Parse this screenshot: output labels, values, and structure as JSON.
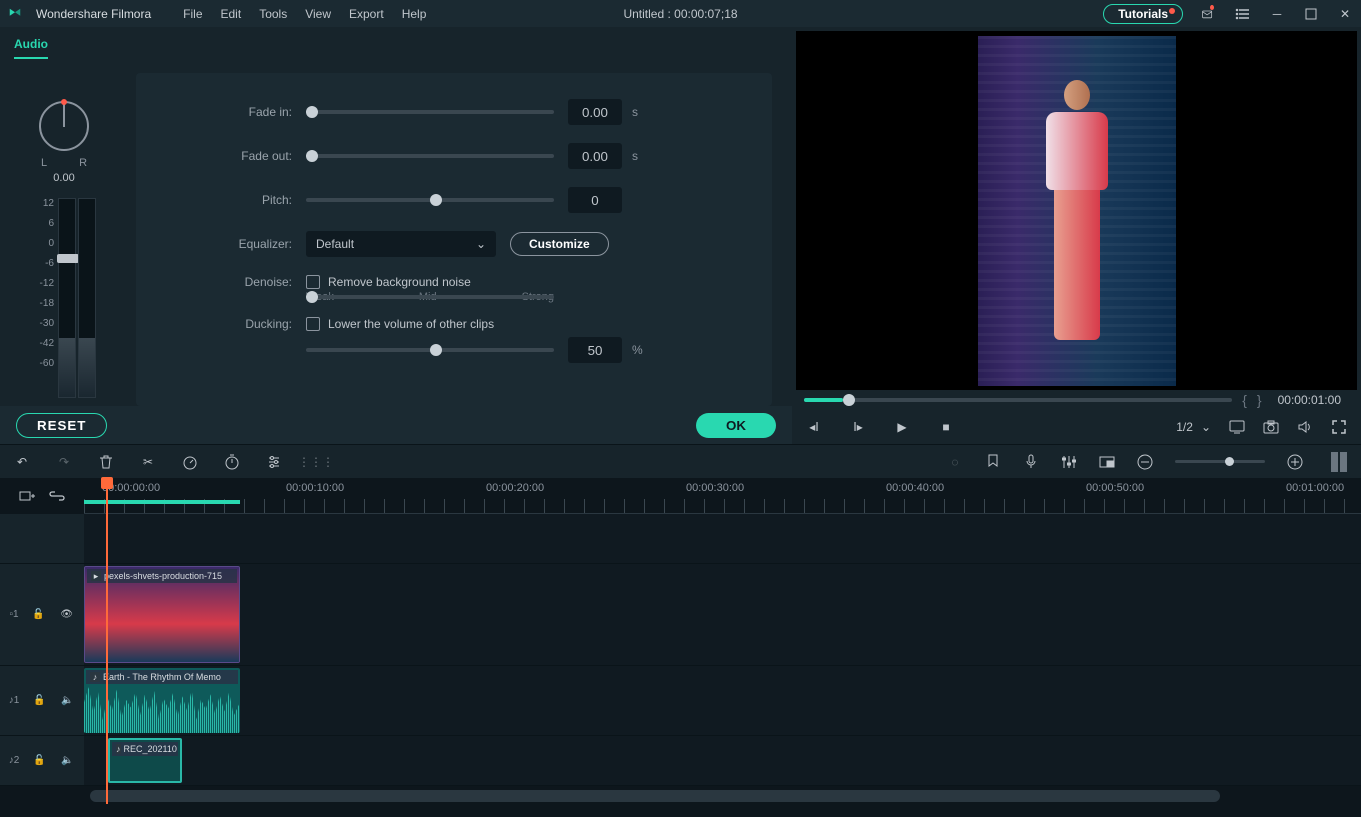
{
  "app": {
    "name": "Wondershare Filmora"
  },
  "menu": {
    "file": "File",
    "edit": "Edit",
    "tools": "Tools",
    "view": "View",
    "export": "Export",
    "help": "Help"
  },
  "title": "Untitled : 00:00:07;18",
  "tutorials": "Tutorials",
  "tab": "Audio",
  "dial": {
    "L": "L",
    "R": "R",
    "value": "0.00"
  },
  "scale": [
    "12",
    "6",
    "0",
    "-6",
    "-12",
    "-18",
    "-30",
    "-42",
    "-60"
  ],
  "audio": {
    "fadein": {
      "label": "Fade in:",
      "value": "0.00",
      "unit": "s"
    },
    "fadeout": {
      "label": "Fade out:",
      "value": "0.00",
      "unit": "s"
    },
    "pitch": {
      "label": "Pitch:",
      "value": "0"
    },
    "equalizer": {
      "label": "Equalizer:",
      "value": "Default",
      "customize": "Customize"
    },
    "denoise": {
      "label": "Denoise:",
      "chk": "Remove background noise",
      "weak": "Weak",
      "mid": "Mid",
      "strong": "Strong"
    },
    "ducking": {
      "label": "Ducking:",
      "chk": "Lower the volume of other clips",
      "value": "50",
      "unit": "%"
    }
  },
  "buttons": {
    "reset": "RESET",
    "ok": "OK"
  },
  "preview": {
    "time": "00:00:01:00",
    "ratio": "1/2"
  },
  "ruler": [
    "00:00:00:00",
    "00:00:10:00",
    "00:00:20:00",
    "00:00:30:00",
    "00:00:40:00",
    "00:00:50:00",
    "00:01:00:00"
  ],
  "tracks": {
    "video": {
      "id": "1",
      "clip": "pexels-shvets-production-715"
    },
    "audio1": {
      "id": "1",
      "clip": "Earth - The Rhythm Of Memo"
    },
    "audio2": {
      "id": "2",
      "clip": "REC_202110"
    }
  }
}
